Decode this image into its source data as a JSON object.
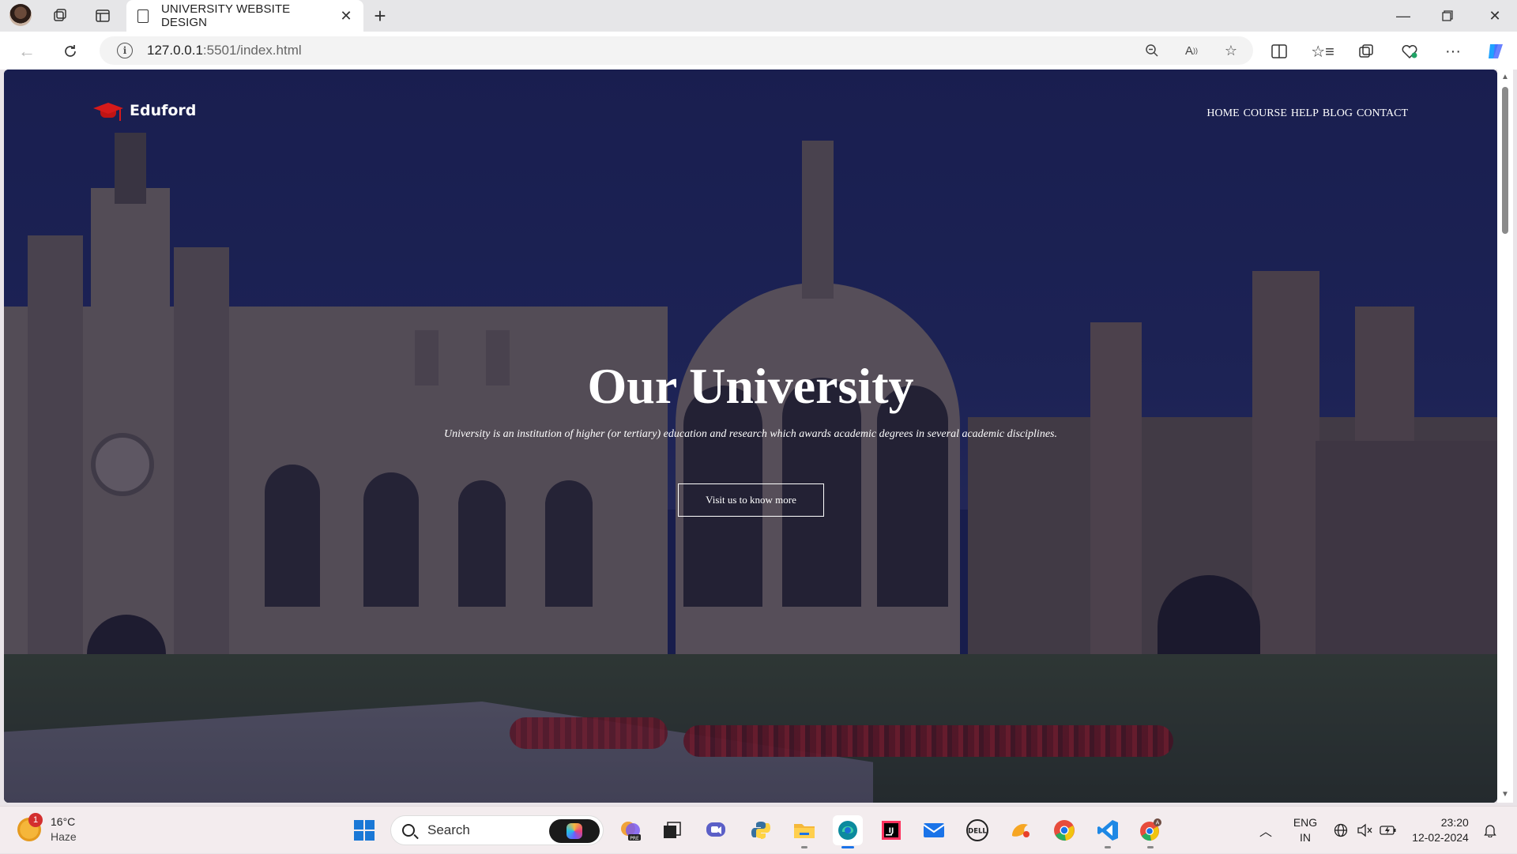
{
  "browser": {
    "tab_title": "UNIVERSITY WEBSITE DESIGN",
    "url_host": "127.0.0.1",
    "url_rest": ":5501/index.html"
  },
  "site": {
    "brand": "Eduford",
    "nav": [
      "HOME",
      "COURSE",
      "HELP",
      "BLOG",
      "CONTACT"
    ],
    "hero_title": "Our University",
    "hero_subtitle": "University is an institution of higher (or tertiary) education and research which awards academic degrees in several academic disciplines.",
    "hero_button": "Visit us to know more"
  },
  "taskbar": {
    "weather_temp": "16°C",
    "weather_condition": "Haze",
    "weather_badge": "1",
    "search_label": "Search",
    "lang_line1": "ENG",
    "lang_line2": "IN",
    "time": "23:20",
    "date": "12-02-2024"
  },
  "colors": {
    "brand_accent": "#d61a1a",
    "hero_overlay": "#141846",
    "taskbar_bg": "#f3ecee"
  }
}
